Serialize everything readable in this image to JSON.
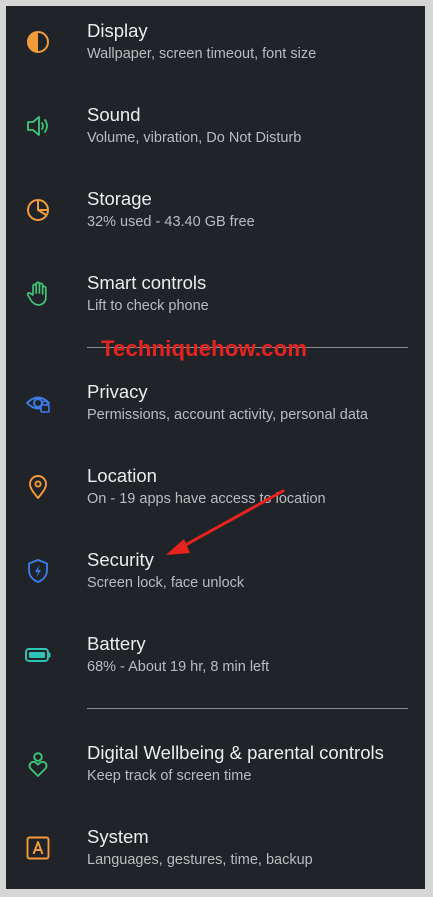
{
  "settings": {
    "items": [
      {
        "title": "Display",
        "subtitle": "Wallpaper, screen timeout, font size",
        "icon": "display-icon",
        "color": "#f29b38"
      },
      {
        "title": "Sound",
        "subtitle": "Volume, vibration, Do Not Disturb",
        "icon": "sound-icon",
        "color": "#3fc57a"
      },
      {
        "title": "Storage",
        "subtitle": "32% used - 43.40 GB free",
        "icon": "storage-icon",
        "color": "#f29b38"
      },
      {
        "title": "Smart controls",
        "subtitle": "Lift to check phone",
        "icon": "hand-icon",
        "color": "#3fc57a"
      },
      {
        "title": "Privacy",
        "subtitle": "Permissions, account activity, personal data",
        "icon": "privacy-eye-icon",
        "color": "#3d7bea"
      },
      {
        "title": "Location",
        "subtitle": "On - 19 apps have access to location",
        "icon": "location-pin-icon",
        "color": "#f29b38"
      },
      {
        "title": "Security",
        "subtitle": "Screen lock, face unlock",
        "icon": "shield-icon",
        "color": "#3d7bea"
      },
      {
        "title": "Battery",
        "subtitle": "68% - About 19 hr, 8 min left",
        "icon": "battery-icon",
        "color": "#2ec4b6"
      },
      {
        "title": "Digital Wellbeing & parental controls",
        "subtitle": "Keep track of screen time",
        "icon": "wellbeing-icon",
        "color": "#3fc57a"
      },
      {
        "title": "System",
        "subtitle": "Languages, gestures, time, backup",
        "icon": "system-icon",
        "color": "#f29b38"
      }
    ]
  },
  "watermark": {
    "text": "Techniquehow.com",
    "color": "#e8231f"
  },
  "annotation": {
    "arrow_color": "#e8231f"
  }
}
